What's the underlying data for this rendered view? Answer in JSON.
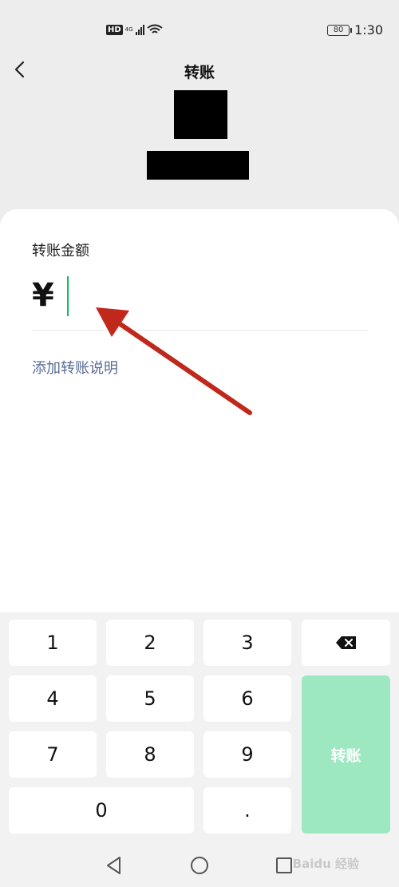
{
  "status": {
    "network": "HD",
    "network_type": "4G",
    "battery": "80",
    "time": "1:30"
  },
  "header": {
    "title": "转账"
  },
  "form": {
    "amount_label": "转账金额",
    "currency_symbol": "¥",
    "add_note": "添加转账说明"
  },
  "keypad": {
    "keys": [
      "1",
      "2",
      "3",
      "4",
      "5",
      "6",
      "7",
      "8",
      "9",
      "0",
      "."
    ],
    "delete_icon": "backspace-icon",
    "transfer_label": "转账"
  },
  "watermark": "Baidu 经验",
  "colors": {
    "caret": "#07c160",
    "link": "#576b95",
    "transfer_button": "#9ee8c1",
    "annotation_arrow": "#c0281b"
  }
}
